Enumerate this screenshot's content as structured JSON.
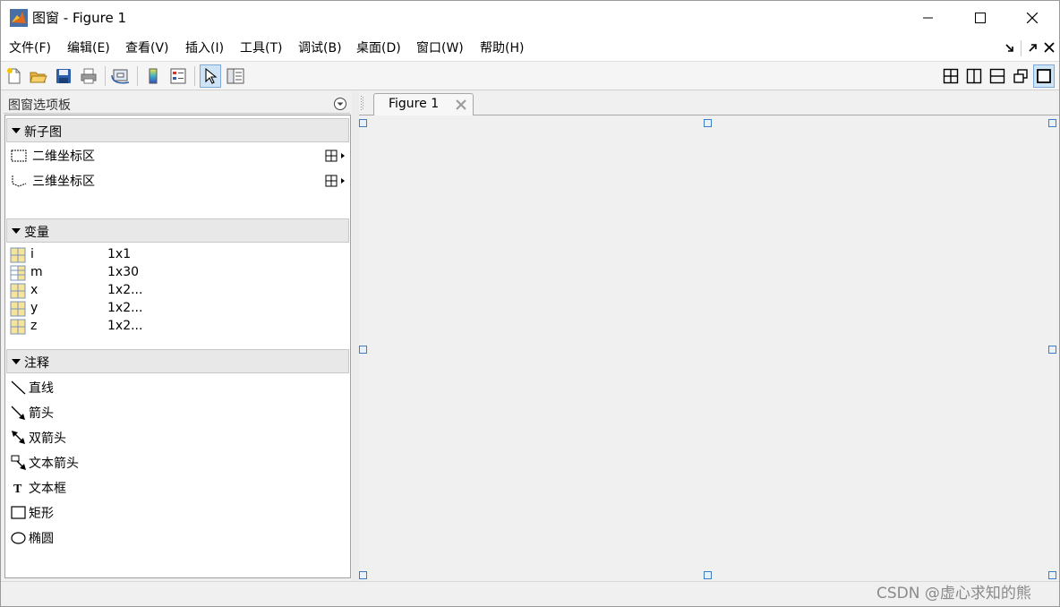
{
  "window": {
    "title": "图窗 - Figure 1"
  },
  "menu": {
    "items": [
      "文件(F)",
      "编辑(E)",
      "查看(V)",
      "插入(I)",
      "工具(T)",
      "调试(B)",
      "桌面(D)",
      "窗口(W)",
      "帮助(H)"
    ]
  },
  "palette": {
    "title": "图窗选项板",
    "sections": {
      "new_subplot": {
        "label": "新子图",
        "items": [
          "二维坐标区",
          "三维坐标区"
        ]
      },
      "variables": {
        "label": "变量",
        "rows": [
          {
            "name": "i",
            "size": "1x1"
          },
          {
            "name": "m",
            "size": "1x30"
          },
          {
            "name": "x",
            "size": "1x2..."
          },
          {
            "name": "y",
            "size": "1x2..."
          },
          {
            "name": "z",
            "size": "1x2..."
          }
        ]
      },
      "annotations": {
        "label": "注释",
        "items": [
          "直线",
          "箭头",
          "双箭头",
          "文本箭头",
          "文本框",
          "矩形",
          "椭圆"
        ]
      }
    }
  },
  "tabs": {
    "figure": "Figure 1"
  },
  "watermark": "CSDN @虚心求知的熊",
  "colors": {
    "accent": "#3b7ec6",
    "tab_active_bg": "#cfe3f7"
  }
}
